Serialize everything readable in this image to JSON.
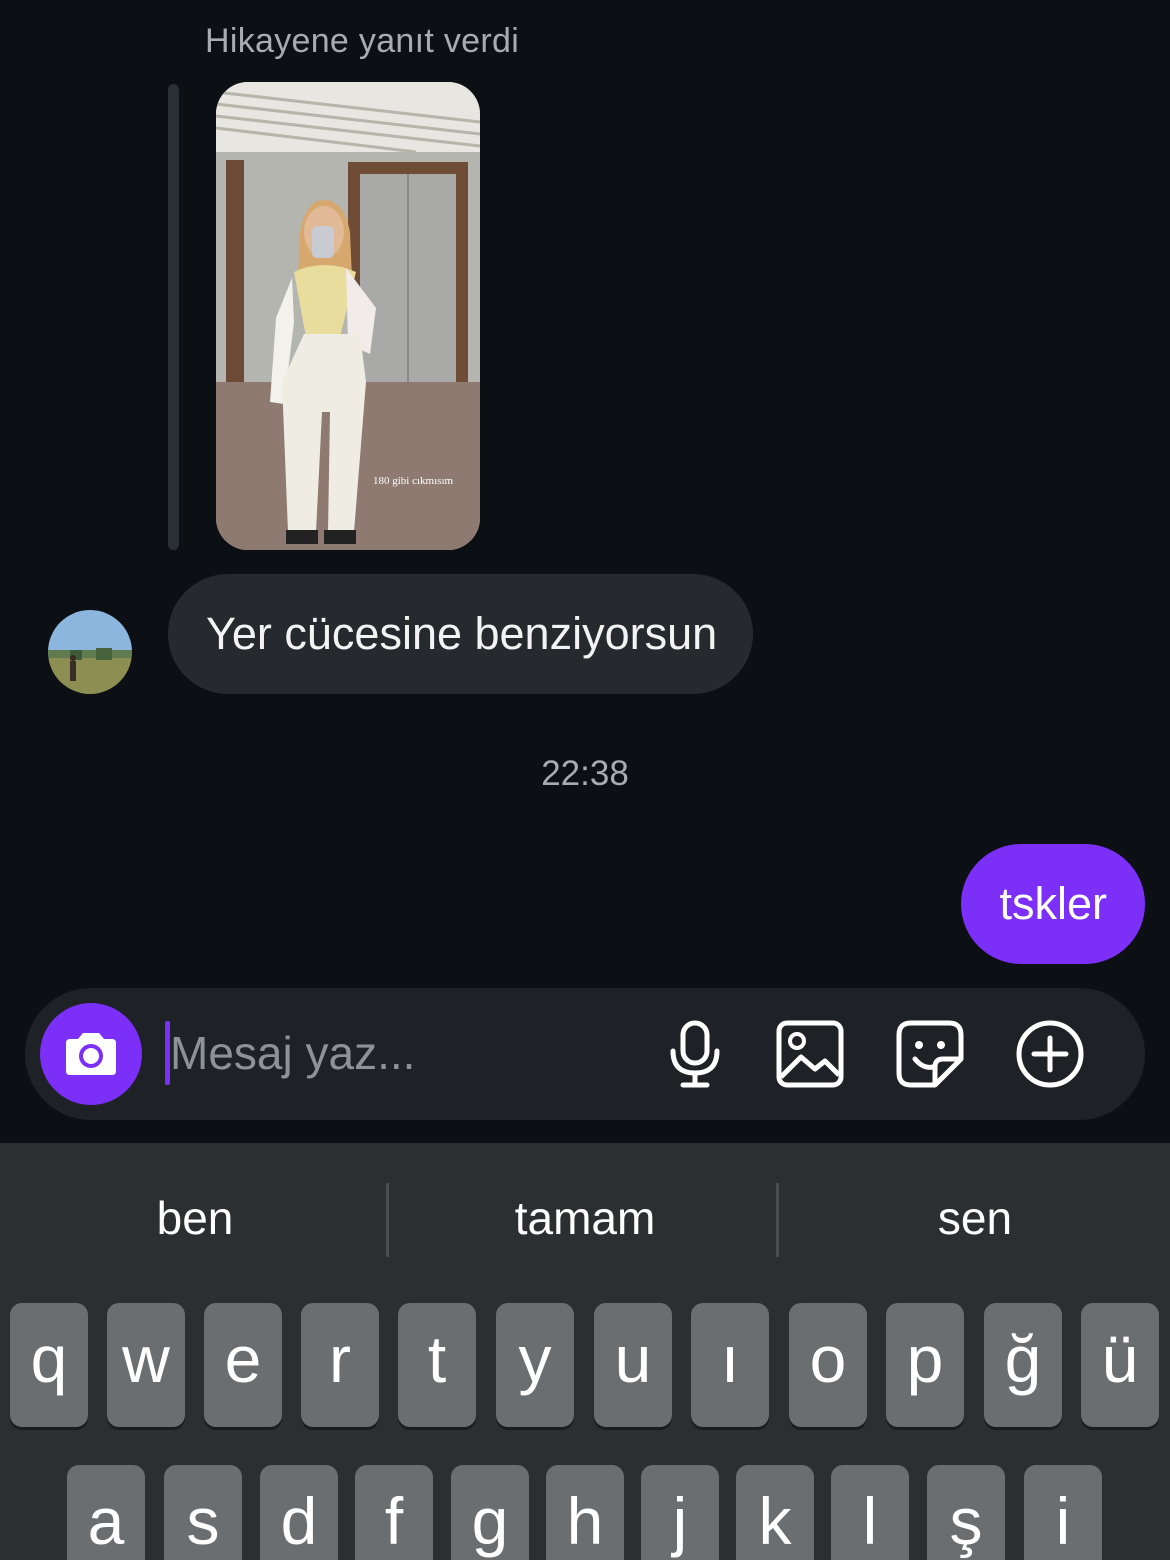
{
  "story": {
    "caption": "Hikayene yanıt verdi",
    "overlay_text": "180 gibi cıkmısım"
  },
  "messages": {
    "incoming_text": "Yer cücesine benziyorsun",
    "timestamp": "22:38",
    "outgoing_text": "tskler"
  },
  "composer": {
    "placeholder": "Mesaj yaz...",
    "value": "",
    "icons": [
      "camera-icon",
      "microphone-icon",
      "gallery-icon",
      "sticker-icon",
      "plus-circle-icon"
    ]
  },
  "keyboard": {
    "suggestions": [
      "ben",
      "tamam",
      "sen"
    ],
    "row1": [
      "q",
      "w",
      "e",
      "r",
      "t",
      "y",
      "u",
      "ı",
      "o",
      "p",
      "ğ",
      "ü"
    ],
    "row2": [
      "a",
      "s",
      "d",
      "f",
      "g",
      "h",
      "j",
      "k",
      "l",
      "ş",
      "i"
    ]
  },
  "colors": {
    "background": "#0c1014",
    "accent": "#7b2ff7",
    "incoming_bubble": "#262a2f",
    "keyboard": "#2b2f31",
    "key": "#6b6e70"
  }
}
